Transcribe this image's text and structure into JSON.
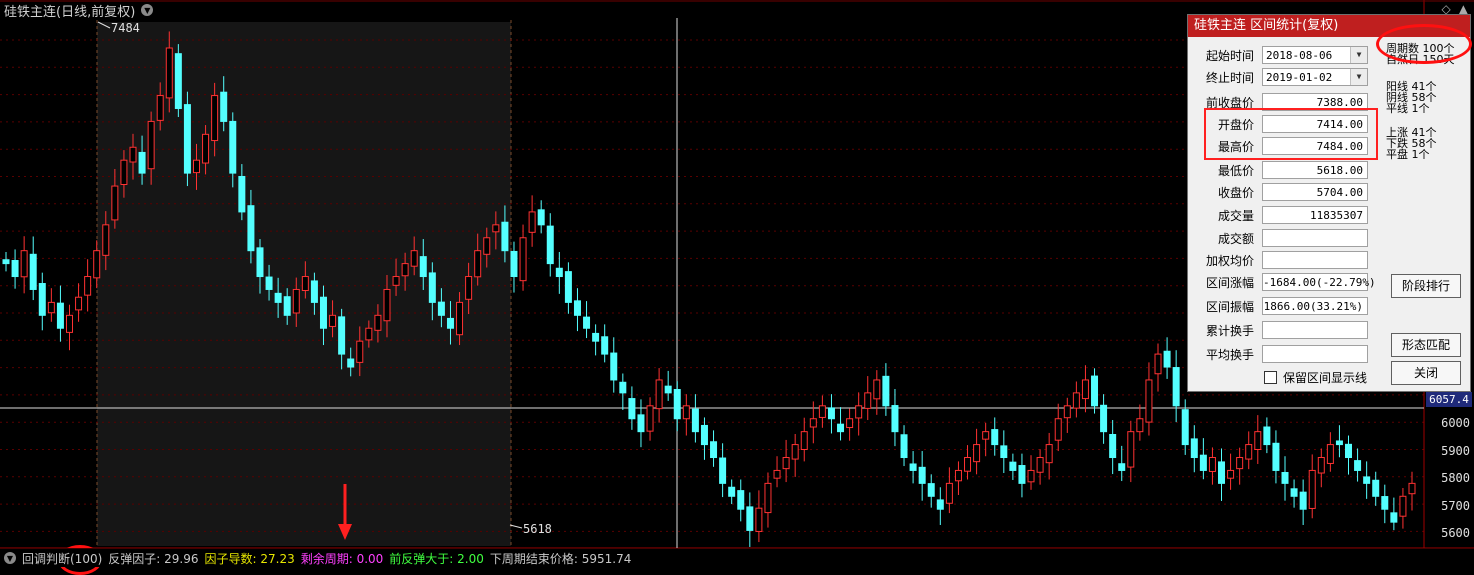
{
  "window": {
    "title": "硅铁主连(日线,前复权)"
  },
  "chart_data": {
    "type": "candlestick",
    "ylim": [
      5550,
      7600
    ],
    "y_ticks": [
      5600,
      5700,
      5800,
      5900,
      6000
    ],
    "current_price": "6057.4",
    "high_marker": "7484",
    "low_marker": "5618",
    "series_close": [
      6650,
      6600,
      6700,
      6550,
      6450,
      6500,
      6400,
      6450,
      6520,
      6600,
      6700,
      6800,
      6950,
      7050,
      7100,
      7000,
      7200,
      7300,
      7484,
      7250,
      7000,
      7050,
      7150,
      7300,
      7200,
      7000,
      6850,
      6700,
      6600,
      6550,
      6500,
      6450,
      6550,
      6600,
      6500,
      6400,
      6450,
      6300,
      6250,
      6350,
      6400,
      6450,
      6550,
      6600,
      6650,
      6700,
      6600,
      6500,
      6450,
      6400,
      6500,
      6600,
      6700,
      6750,
      6800,
      6700,
      6600,
      6750,
      6850,
      6800,
      6650,
      6600,
      6500,
      6450,
      6400,
      6350,
      6300,
      6200,
      6150,
      6050,
      6000,
      6100,
      6200,
      6150,
      6050,
      6100,
      6000,
      5950,
      5900,
      5800,
      5750,
      5700,
      5618,
      5704,
      5800,
      5850,
      5900,
      5950,
      6000,
      6050,
      6100,
      6050,
      6000,
      6050,
      6100,
      6150,
      6200,
      6100,
      6000,
      5900,
      5850,
      5800,
      5750,
      5700,
      5800,
      5850,
      5900,
      5950,
      6000,
      5950,
      5900,
      5850,
      5800,
      5850,
      5900,
      5950,
      6050,
      6100,
      6150,
      6200,
      6100,
      6000,
      5900,
      5850,
      6000,
      6050,
      6200,
      6300,
      6250,
      6100,
      5950,
      5900,
      5850,
      5900,
      5800,
      5850,
      5900,
      5950,
      6000,
      5950,
      5850,
      5800,
      5750,
      5700,
      5850,
      5900,
      5950,
      5950,
      5900,
      5850,
      5800,
      5750,
      5700,
      5650,
      5750,
      5800
    ]
  },
  "dialog": {
    "title": "硅铁主连 区间统计(复权)",
    "fields": [
      {
        "label": "起始时间",
        "value": "2018-08-06"
      },
      {
        "label": "终止时间",
        "value": "2019-01-02"
      },
      {
        "label": "前收盘价",
        "value": "7388.00"
      },
      {
        "label": "开盘价",
        "value": "7414.00"
      },
      {
        "label": "最高价",
        "value": "7484.00"
      },
      {
        "label": "最低价",
        "value": "5618.00"
      },
      {
        "label": "收盘价",
        "value": "5704.00"
      },
      {
        "label": "成交量",
        "value": "11835307"
      },
      {
        "label": "成交额",
        "value": ""
      },
      {
        "label": "加权均价",
        "value": ""
      },
      {
        "label": "区间涨幅",
        "value": "-1684.00(-22.79%)"
      },
      {
        "label": "区间振幅",
        "value": "1866.00(33.21%)"
      },
      {
        "label": "累计换手",
        "value": ""
      },
      {
        "label": "平均换手",
        "value": ""
      }
    ],
    "stats_a": [
      "周期数 100个",
      "自然日 150天"
    ],
    "stats_b": [
      "阳线 41个",
      "阴线 58个",
      "平线 1个"
    ],
    "stats_c": [
      "上涨 41个",
      "下跌 58个",
      "平盘 1个"
    ],
    "buttons": {
      "rank": "阶段排行",
      "match": "形态匹配",
      "close": "关闭"
    },
    "checkbox_label": "保留区间显示线"
  },
  "status": {
    "t1": "回调判断(100)",
    "t2": "反弹因子: 29.96",
    "t3": "因子导数: 27.23",
    "t4": "剩余周期: 0.00",
    "t5": "前反弹大于: 2.00",
    "t6": "下周期结束价格: 5951.74"
  }
}
